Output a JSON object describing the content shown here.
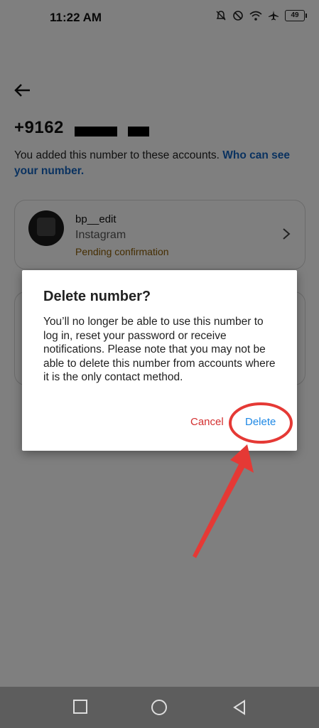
{
  "status_bar": {
    "time": "11:22 AM",
    "battery": "49",
    "icons": [
      "bell-muted-icon",
      "do-not-disturb-icon",
      "wifi-icon",
      "airplane-icon",
      "battery-icon"
    ]
  },
  "page": {
    "back_icon": "arrow-left-icon",
    "phone_number": "+9162",
    "info_text": "You added this number to these accounts. ",
    "info_link": "Who can see your number."
  },
  "account": {
    "username": "bp__edit",
    "platform": "Instagram",
    "status": "Pending confirmation",
    "chevron_icon": "chevron-right-icon"
  },
  "dialog": {
    "title": "Delete number?",
    "body": "You’ll no longer be able to use this number to log in, reset your password or receive notifications. Please note that you may not be able to delete this number from accounts where it is the only contact method.",
    "cancel_label": "Cancel",
    "delete_label": "Delete"
  },
  "annotation": {
    "color": "#e53935"
  },
  "nav_bar": {
    "icons": [
      "recents-square-icon",
      "home-circle-icon",
      "back-triangle-icon"
    ]
  }
}
